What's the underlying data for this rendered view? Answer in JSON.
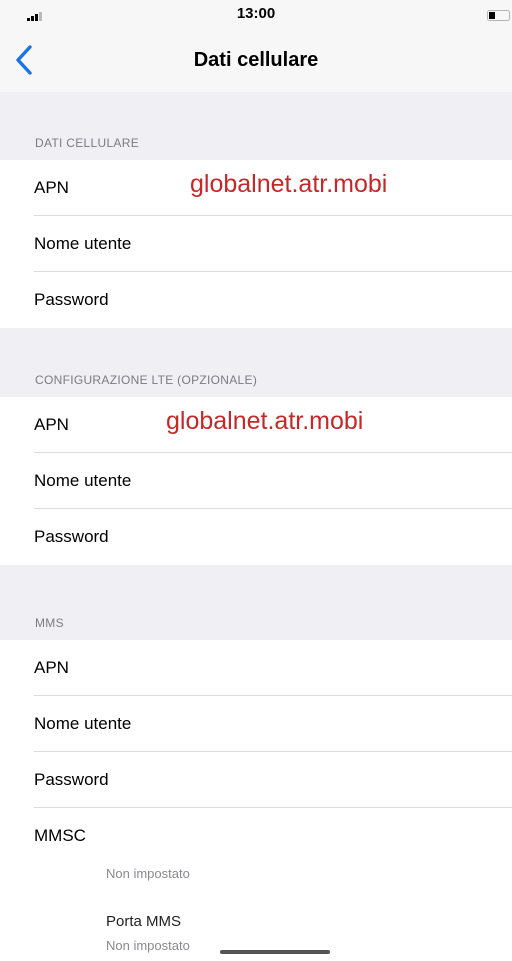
{
  "status_bar": {
    "time": "13:00",
    "signal_icon": "signal-bars-icon",
    "battery_icon": "battery-icon"
  },
  "nav": {
    "back_icon": "chevron-left-icon",
    "title": "Dati cellulare",
    "accent_color": "#1a73e8"
  },
  "sections": {
    "dati_cellulare": {
      "header": "DATI CELLULARE",
      "rows": [
        {
          "label": "APN",
          "value": "globalnet.atr.mobi"
        },
        {
          "label": "Nome utente",
          "value": ""
        },
        {
          "label": "Password",
          "value": ""
        }
      ]
    },
    "lte": {
      "header": "CONFIGURAZIONE LTE (OPZIONALE)",
      "rows": [
        {
          "label": "APN",
          "value": "globalnet.atr.mobi"
        },
        {
          "label": "Nome utente",
          "value": ""
        },
        {
          "label": "Password",
          "value": ""
        }
      ]
    },
    "mms": {
      "header": "MMS",
      "rows": [
        {
          "label": "APN"
        },
        {
          "label": "Nome utente"
        },
        {
          "label": "Password"
        },
        {
          "label": "MMSC"
        }
      ],
      "mmsc_value": "Non impostato",
      "porta_mms_label": "Porta MMS",
      "porta_mms_value": "Non impostato"
    }
  },
  "colors": {
    "highlight_text": "#c62828",
    "group_background": "#efeff4"
  }
}
